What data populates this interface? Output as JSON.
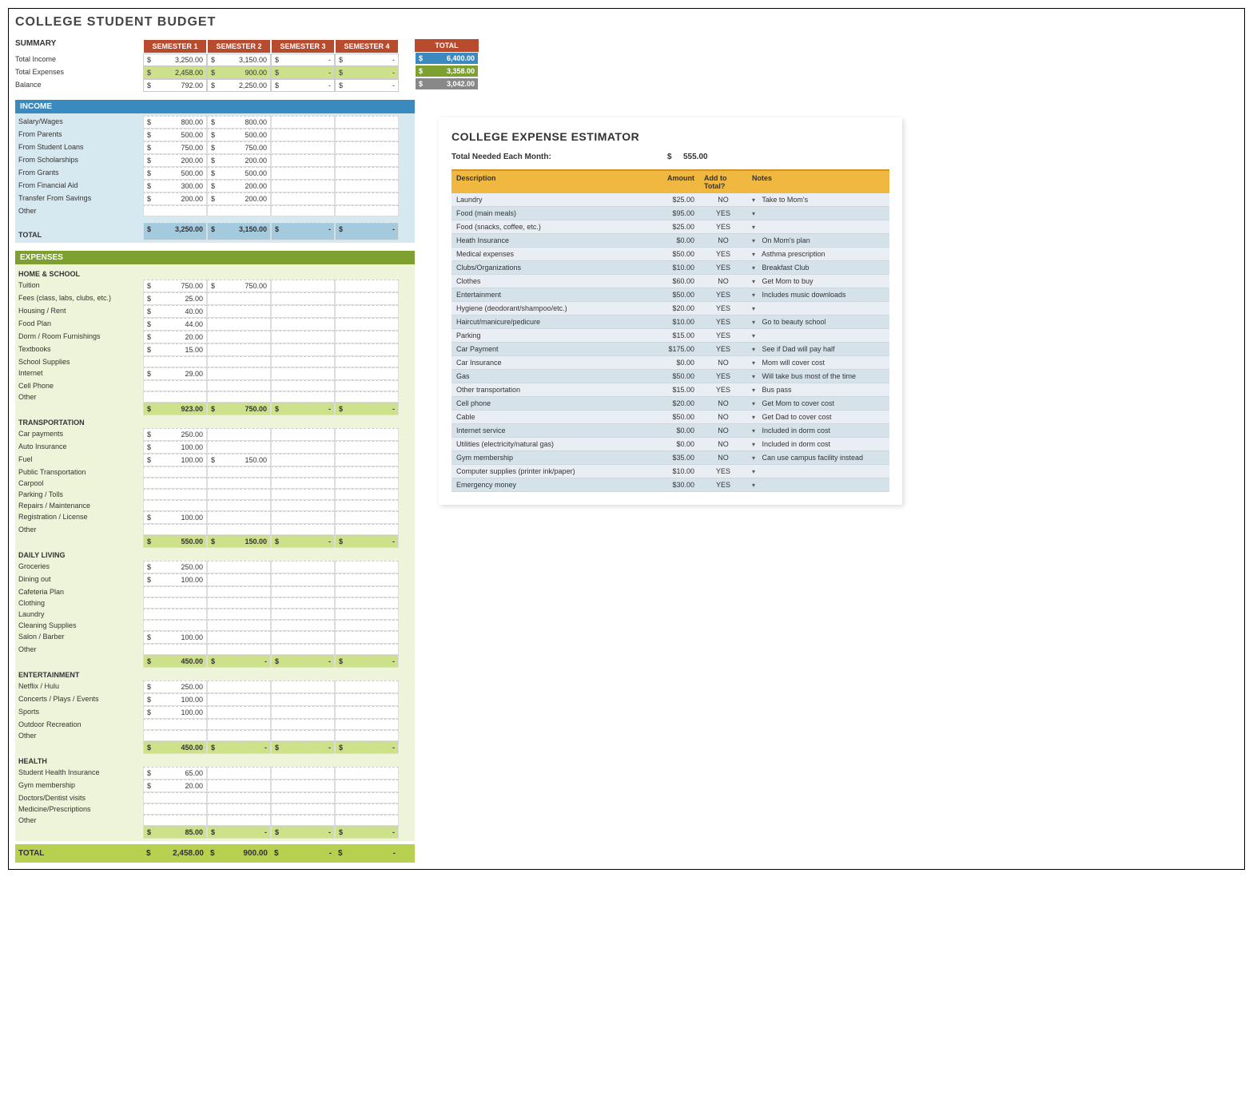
{
  "title": "COLLEGE STUDENT BUDGET",
  "summary": {
    "label": "SUMMARY",
    "headers": [
      "SEMESTER 1",
      "SEMESTER 2",
      "SEMESTER 3",
      "SEMESTER 4"
    ],
    "total_header": "TOTAL",
    "rows": [
      {
        "label": "Total Income",
        "cells": [
          "3,250.00",
          "3,150.00",
          "-",
          "-"
        ],
        "total": "6,400.00",
        "class": "total-income"
      },
      {
        "label": "Total Expenses",
        "cells": [
          "2,458.00",
          "900.00",
          "-",
          "-"
        ],
        "total": "3,358.00",
        "class": "total-exp",
        "cellclass": "exp"
      },
      {
        "label": "Balance",
        "cells": [
          "792.00",
          "2,250.00",
          "-",
          "-"
        ],
        "total": "3,042.00",
        "class": "total-bal"
      }
    ]
  },
  "income": {
    "header": "INCOME",
    "rows": [
      {
        "label": "Salary/Wages",
        "cells": [
          "800.00",
          "800.00",
          "",
          ""
        ]
      },
      {
        "label": "From Parents",
        "cells": [
          "500.00",
          "500.00",
          "",
          ""
        ]
      },
      {
        "label": "From Student Loans",
        "cells": [
          "750.00",
          "750.00",
          "",
          ""
        ]
      },
      {
        "label": "From Scholarships",
        "cells": [
          "200.00",
          "200.00",
          "",
          ""
        ]
      },
      {
        "label": "From Grants",
        "cells": [
          "500.00",
          "500.00",
          "",
          ""
        ]
      },
      {
        "label": "From Financial Aid",
        "cells": [
          "300.00",
          "200.00",
          "",
          ""
        ]
      },
      {
        "label": "Transfer From Savings",
        "cells": [
          "200.00",
          "200.00",
          "",
          ""
        ]
      },
      {
        "label": "Other",
        "cells": [
          "",
          "",
          "",
          ""
        ]
      }
    ],
    "total": {
      "label": "TOTAL",
      "cells": [
        "3,250.00",
        "3,150.00",
        "-",
        "-"
      ]
    }
  },
  "expenses": {
    "header": "EXPENSES",
    "sections": [
      {
        "title": "HOME & SCHOOL",
        "rows": [
          {
            "label": "Tuition",
            "cells": [
              "750.00",
              "750.00",
              "",
              ""
            ]
          },
          {
            "label": "Fees (class, labs, clubs, etc.)",
            "cells": [
              "25.00",
              "",
              "",
              ""
            ]
          },
          {
            "label": "Housing / Rent",
            "cells": [
              "40.00",
              "",
              "",
              ""
            ]
          },
          {
            "label": "Food Plan",
            "cells": [
              "44.00",
              "",
              "",
              ""
            ]
          },
          {
            "label": "Dorm / Room Furnishings",
            "cells": [
              "20.00",
              "",
              "",
              ""
            ]
          },
          {
            "label": "Textbooks",
            "cells": [
              "15.00",
              "",
              "",
              ""
            ]
          },
          {
            "label": "School Supplies",
            "cells": [
              "",
              "",
              "",
              ""
            ]
          },
          {
            "label": "Internet",
            "cells": [
              "29.00",
              "",
              "",
              ""
            ]
          },
          {
            "label": "Cell Phone",
            "cells": [
              "",
              "",
              "",
              ""
            ]
          },
          {
            "label": "Other",
            "cells": [
              "",
              "",
              "",
              ""
            ]
          }
        ],
        "subtotal": [
          "923.00",
          "750.00",
          "-",
          "-"
        ]
      },
      {
        "title": "TRANSPORTATION",
        "rows": [
          {
            "label": "Car payments",
            "cells": [
              "250.00",
              "",
              "",
              ""
            ]
          },
          {
            "label": "Auto Insurance",
            "cells": [
              "100.00",
              "",
              "",
              ""
            ]
          },
          {
            "label": "Fuel",
            "cells": [
              "100.00",
              "150.00",
              "",
              ""
            ]
          },
          {
            "label": "Public Transportation",
            "cells": [
              "",
              "",
              "",
              ""
            ]
          },
          {
            "label": "Carpool",
            "cells": [
              "",
              "",
              "",
              ""
            ]
          },
          {
            "label": "Parking / Tolls",
            "cells": [
              "",
              "",
              "",
              ""
            ]
          },
          {
            "label": "Repairs / Maintenance",
            "cells": [
              "",
              "",
              "",
              ""
            ]
          },
          {
            "label": "Registration / License",
            "cells": [
              "100.00",
              "",
              "",
              ""
            ]
          },
          {
            "label": "Other",
            "cells": [
              "",
              "",
              "",
              ""
            ]
          }
        ],
        "subtotal": [
          "550.00",
          "150.00",
          "-",
          "-"
        ]
      },
      {
        "title": "DAILY LIVING",
        "rows": [
          {
            "label": "Groceries",
            "cells": [
              "250.00",
              "",
              "",
              ""
            ]
          },
          {
            "label": "Dining out",
            "cells": [
              "100.00",
              "",
              "",
              ""
            ]
          },
          {
            "label": "Cafeteria Plan",
            "cells": [
              "",
              "",
              "",
              ""
            ]
          },
          {
            "label": "Clothing",
            "cells": [
              "",
              "",
              "",
              ""
            ]
          },
          {
            "label": "Laundry",
            "cells": [
              "",
              "",
              "",
              ""
            ]
          },
          {
            "label": "Cleaning Supplies",
            "cells": [
              "",
              "",
              "",
              ""
            ]
          },
          {
            "label": "Salon / Barber",
            "cells": [
              "100.00",
              "",
              "",
              ""
            ]
          },
          {
            "label": "Other",
            "cells": [
              "",
              "",
              "",
              ""
            ]
          }
        ],
        "subtotal": [
          "450.00",
          "-",
          "-",
          "-"
        ]
      },
      {
        "title": "ENTERTAINMENT",
        "rows": [
          {
            "label": "Netflix / Hulu",
            "cells": [
              "250.00",
              "",
              "",
              ""
            ]
          },
          {
            "label": "Concerts / Plays / Events",
            "cells": [
              "100.00",
              "",
              "",
              ""
            ]
          },
          {
            "label": "Sports",
            "cells": [
              "100.00",
              "",
              "",
              ""
            ]
          },
          {
            "label": "Outdoor Recreation",
            "cells": [
              "",
              "",
              "",
              ""
            ]
          },
          {
            "label": "Other",
            "cells": [
              "",
              "",
              "",
              ""
            ]
          }
        ],
        "subtotal": [
          "450.00",
          "-",
          "-",
          "-"
        ]
      },
      {
        "title": "HEALTH",
        "rows": [
          {
            "label": "Student Health Insurance",
            "cells": [
              "65.00",
              "",
              "",
              ""
            ]
          },
          {
            "label": "Gym membership",
            "cells": [
              "20.00",
              "",
              "",
              ""
            ]
          },
          {
            "label": "Doctors/Dentist visits",
            "cells": [
              "",
              "",
              "",
              ""
            ]
          },
          {
            "label": "Medicine/Prescriptions",
            "cells": [
              "",
              "",
              "",
              ""
            ]
          },
          {
            "label": "Other",
            "cells": [
              "",
              "",
              "",
              ""
            ]
          }
        ],
        "subtotal": [
          "85.00",
          "-",
          "-",
          "-"
        ]
      }
    ],
    "grand_total": {
      "label": "TOTAL",
      "cells": [
        "2,458.00",
        "900.00",
        "-",
        "-"
      ]
    }
  },
  "estimator": {
    "title": "COLLEGE EXPENSE ESTIMATOR",
    "total_label": "Total Needed Each Month:",
    "total_value": "555.00",
    "headers": [
      "Description",
      "Amount",
      "Add to Total?",
      "Notes"
    ],
    "rows": [
      {
        "desc": "Laundry",
        "amount": "$25.00",
        "add": "NO",
        "notes": "Take to Mom's"
      },
      {
        "desc": "Food (main meals)",
        "amount": "$95.00",
        "add": "YES",
        "notes": ""
      },
      {
        "desc": "Food (snacks, coffee, etc.)",
        "amount": "$25.00",
        "add": "YES",
        "notes": ""
      },
      {
        "desc": "Heath Insurance",
        "amount": "$0.00",
        "add": "NO",
        "notes": "On Mom's plan"
      },
      {
        "desc": "Medical expenses",
        "amount": "$50.00",
        "add": "YES",
        "notes": "Asthma prescription"
      },
      {
        "desc": "Clubs/Organizations",
        "amount": "$10.00",
        "add": "YES",
        "notes": "Breakfast Club"
      },
      {
        "desc": "Clothes",
        "amount": "$60.00",
        "add": "NO",
        "notes": "Get Mom to buy"
      },
      {
        "desc": "Entertainment",
        "amount": "$50.00",
        "add": "YES",
        "notes": "Includes music downloads"
      },
      {
        "desc": "Hygiene (deodorant/shampoo/etc.)",
        "amount": "$20.00",
        "add": "YES",
        "notes": ""
      },
      {
        "desc": "Haircut/manicure/pedicure",
        "amount": "$10.00",
        "add": "YES",
        "notes": "Go to beauty school"
      },
      {
        "desc": "Parking",
        "amount": "$15.00",
        "add": "YES",
        "notes": ""
      },
      {
        "desc": "Car Payment",
        "amount": "$175.00",
        "add": "YES",
        "notes": "See if Dad will pay half"
      },
      {
        "desc": "Car Insurance",
        "amount": "$0.00",
        "add": "NO",
        "notes": "Mom will cover cost"
      },
      {
        "desc": "Gas",
        "amount": "$50.00",
        "add": "YES",
        "notes": "Will take bus most of the time"
      },
      {
        "desc": "Other transportation",
        "amount": "$15.00",
        "add": "YES",
        "notes": "Bus pass"
      },
      {
        "desc": "Cell phone",
        "amount": "$20.00",
        "add": "NO",
        "notes": "Get Mom to cover cost"
      },
      {
        "desc": "Cable",
        "amount": "$50.00",
        "add": "NO",
        "notes": "Get Dad to cover cost"
      },
      {
        "desc": "Internet service",
        "amount": "$0.00",
        "add": "NO",
        "notes": "Included in dorm cost"
      },
      {
        "desc": "Utilities (electricity/natural gas)",
        "amount": "$0.00",
        "add": "NO",
        "notes": "Included in dorm cost"
      },
      {
        "desc": "Gym membership",
        "amount": "$35.00",
        "add": "NO",
        "notes": "Can use campus facility instead"
      },
      {
        "desc": "Computer supplies (printer ink/paper)",
        "amount": "$10.00",
        "add": "YES",
        "notes": ""
      },
      {
        "desc": "Emergency money",
        "amount": "$30.00",
        "add": "YES",
        "notes": ""
      }
    ]
  }
}
